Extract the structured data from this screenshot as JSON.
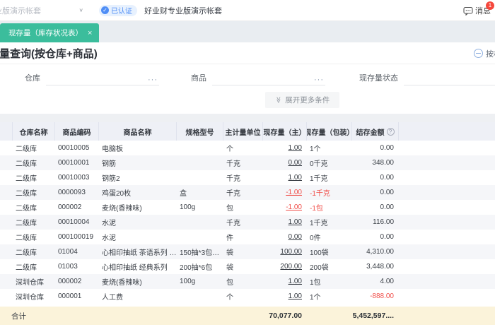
{
  "topbar": {
    "account_selector": "专业版演示帐套",
    "verified_badge": "已认证",
    "company_name": "好业财专业版演示帐套",
    "messages_label": "消息",
    "messages_badge": "1"
  },
  "tab": {
    "label": "现存量（库存状况表）",
    "close": "×"
  },
  "page": {
    "title": "现存量查询(按仓库+商品)",
    "corner_action": "按相"
  },
  "filters": {
    "warehouse_label": "仓库",
    "product_label": "商品",
    "status_label": "现存量状态",
    "more_button": "展开更多条件"
  },
  "icons": {
    "chevron_down": "∨",
    "double_chevron_down": "≫",
    "ellipsis": "···",
    "check": "✓",
    "question": "?"
  },
  "colors": {
    "tab_green": "#3bbd9c",
    "negative_red": "#f04f4a",
    "badge_blue": "#4e8df6",
    "footer_beige": "#fbf3da"
  },
  "table": {
    "columns": [
      "仓库名称",
      "商品编码",
      "商品名称",
      "规格型号",
      "主计量单位",
      "现存量（主）",
      "现存量（包装）",
      "结存金额"
    ],
    "rows": [
      {
        "w": "二级库",
        "c": "00010005",
        "n": "电脑板",
        "s": "",
        "u": "个",
        "q": "1.00",
        "p": "1个",
        "a": "0.00",
        "qneg": false,
        "aneg": false
      },
      {
        "w": "二级库",
        "c": "00010001",
        "n": "钢筋",
        "s": "",
        "u": "千克",
        "q": "0.00",
        "p": "0千克",
        "a": "348.00",
        "qneg": false,
        "aneg": false
      },
      {
        "w": "二级库",
        "c": "00010003",
        "n": "钢筋2",
        "s": "",
        "u": "千克",
        "q": "1.00",
        "p": "1千克",
        "a": "0.00",
        "qneg": false,
        "aneg": false
      },
      {
        "w": "二级库",
        "c": "0000093",
        "n": "鸡蛋20枚",
        "s": "盒",
        "u": "千克",
        "q": "-1.00",
        "p": "-1千克",
        "a": "0.00",
        "qneg": true,
        "aneg": false
      },
      {
        "w": "二级库",
        "c": "000002",
        "n": "麦烧(香辣味)",
        "s": "100g",
        "u": "包",
        "q": "-1.00",
        "p": "-1包",
        "a": "0.00",
        "qneg": true,
        "aneg": false
      },
      {
        "w": "二级库",
        "c": "00010004",
        "n": "水泥",
        "s": "",
        "u": "千克",
        "q": "1.00",
        "p": "1千克",
        "a": "116.00",
        "qneg": false,
        "aneg": false
      },
      {
        "w": "二级库",
        "c": "000100019",
        "n": "水泥",
        "s": "",
        "u": "件",
        "q": "0.00",
        "p": "0件",
        "a": "0.00",
        "qneg": false,
        "aneg": false
      },
      {
        "w": "二级库",
        "c": "01004",
        "n": "心相印抽纸 茶语系列 …",
        "s": "150抽*3包…",
        "u": "袋",
        "q": "100.00",
        "p": "100袋",
        "a": "4,310.00",
        "qneg": false,
        "aneg": false
      },
      {
        "w": "二级库",
        "c": "01003",
        "n": "心相印抽纸 经典系列",
        "s": "200抽*6包",
        "u": "袋",
        "q": "200.00",
        "p": "200袋",
        "a": "3,448.00",
        "qneg": false,
        "aneg": false
      },
      {
        "w": "深圳仓库",
        "c": "000002",
        "n": "麦烧(香辣味)",
        "s": "100g",
        "u": "包",
        "q": "1.00",
        "p": "1包",
        "a": "4.00",
        "qneg": false,
        "aneg": false
      },
      {
        "w": "深圳仓库",
        "c": "000001",
        "n": "人工费",
        "s": "",
        "u": "个",
        "q": "1.00",
        "p": "1个",
        "a": "-888.00",
        "qneg": false,
        "aneg": true
      }
    ],
    "footer": {
      "label": "合计",
      "qty_total": "70,077.00",
      "amount_total": "5,452,597...."
    }
  }
}
